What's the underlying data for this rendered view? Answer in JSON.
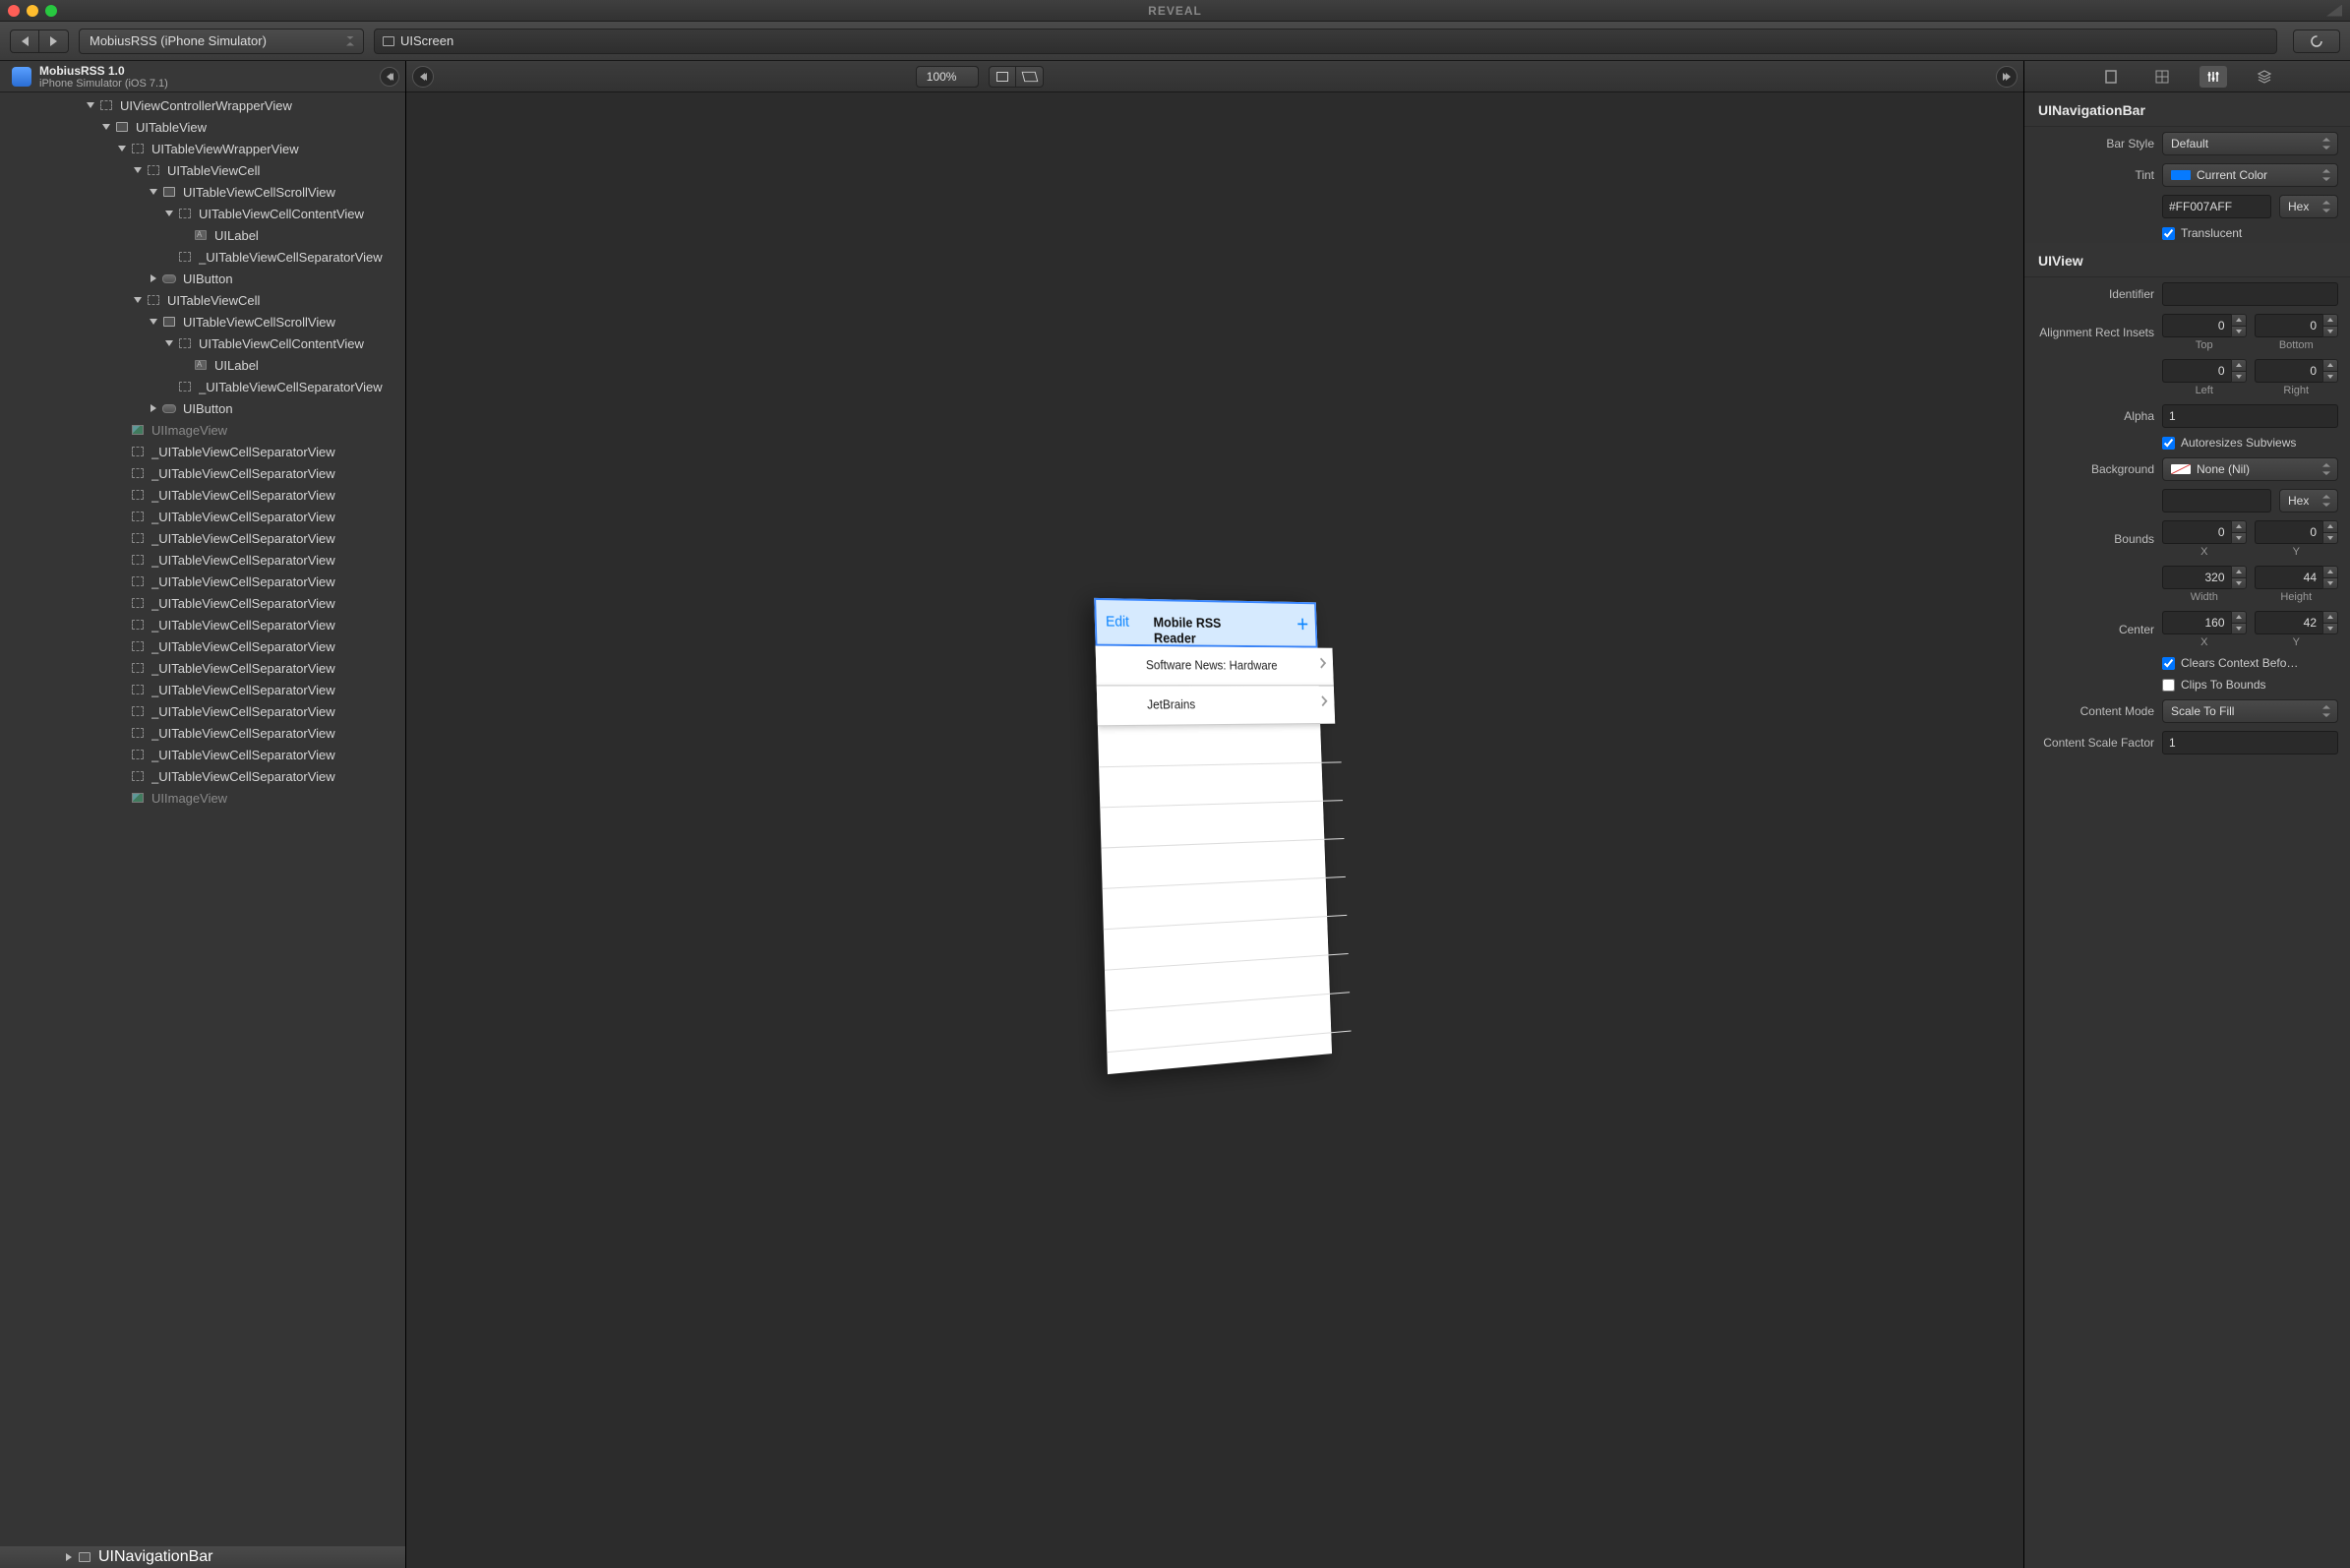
{
  "app": {
    "title": "REVEAL"
  },
  "toolbar": {
    "process": "MobiusRSS (iPhone Simulator)",
    "breadcrumb": "UIScreen"
  },
  "left": {
    "title": "MobiusRSS 1.0",
    "subtitle": "iPhone Simulator (iOS 7.1)",
    "tree": [
      {
        "d": 5,
        "o": true,
        "i": "box",
        "t": "UIViewControllerWrapperView"
      },
      {
        "d": 6,
        "o": true,
        "i": "solid",
        "t": "UITableView"
      },
      {
        "d": 7,
        "o": true,
        "i": "box",
        "t": "UITableViewWrapperView"
      },
      {
        "d": 8,
        "o": true,
        "i": "box",
        "t": "UITableViewCell"
      },
      {
        "d": 9,
        "o": true,
        "i": "solid",
        "t": "UITableViewCellScrollView"
      },
      {
        "d": 10,
        "o": true,
        "i": "box",
        "t": "UITableViewCellContentView"
      },
      {
        "d": 11,
        "o": null,
        "i": "label",
        "t": "UILabel"
      },
      {
        "d": 10,
        "o": null,
        "i": "box",
        "t": "_UITableViewCellSeparatorView"
      },
      {
        "d": 9,
        "o": false,
        "i": "btn",
        "t": "UIButton"
      },
      {
        "d": 8,
        "o": true,
        "i": "box",
        "t": "UITableViewCell"
      },
      {
        "d": 9,
        "o": true,
        "i": "solid",
        "t": "UITableViewCellScrollView"
      },
      {
        "d": 10,
        "o": true,
        "i": "box",
        "t": "UITableViewCellContentView"
      },
      {
        "d": 11,
        "o": null,
        "i": "label",
        "t": "UILabel"
      },
      {
        "d": 10,
        "o": null,
        "i": "box",
        "t": "_UITableViewCellSeparatorView"
      },
      {
        "d": 9,
        "o": false,
        "i": "btn",
        "t": "UIButton"
      },
      {
        "d": 7,
        "o": null,
        "i": "img",
        "t": "UIImageView",
        "dim": true
      },
      {
        "d": 7,
        "o": null,
        "i": "box",
        "t": "_UITableViewCellSeparatorView"
      },
      {
        "d": 7,
        "o": null,
        "i": "box",
        "t": "_UITableViewCellSeparatorView"
      },
      {
        "d": 7,
        "o": null,
        "i": "box",
        "t": "_UITableViewCellSeparatorView"
      },
      {
        "d": 7,
        "o": null,
        "i": "box",
        "t": "_UITableViewCellSeparatorView"
      },
      {
        "d": 7,
        "o": null,
        "i": "box",
        "t": "_UITableViewCellSeparatorView"
      },
      {
        "d": 7,
        "o": null,
        "i": "box",
        "t": "_UITableViewCellSeparatorView"
      },
      {
        "d": 7,
        "o": null,
        "i": "box",
        "t": "_UITableViewCellSeparatorView"
      },
      {
        "d": 7,
        "o": null,
        "i": "box",
        "t": "_UITableViewCellSeparatorView"
      },
      {
        "d": 7,
        "o": null,
        "i": "box",
        "t": "_UITableViewCellSeparatorView"
      },
      {
        "d": 7,
        "o": null,
        "i": "box",
        "t": "_UITableViewCellSeparatorView"
      },
      {
        "d": 7,
        "o": null,
        "i": "box",
        "t": "_UITableViewCellSeparatorView"
      },
      {
        "d": 7,
        "o": null,
        "i": "box",
        "t": "_UITableViewCellSeparatorView"
      },
      {
        "d": 7,
        "o": null,
        "i": "box",
        "t": "_UITableViewCellSeparatorView"
      },
      {
        "d": 7,
        "o": null,
        "i": "box",
        "t": "_UITableViewCellSeparatorView"
      },
      {
        "d": 7,
        "o": null,
        "i": "box",
        "t": "_UITableViewCellSeparatorView"
      },
      {
        "d": 7,
        "o": null,
        "i": "box",
        "t": "_UITableViewCellSeparatorView"
      },
      {
        "d": 7,
        "o": null,
        "i": "img",
        "t": "UIImageView",
        "dim": true
      }
    ],
    "selected": "UINavigationBar"
  },
  "center": {
    "zoom": "100%",
    "nav": {
      "edit": "Edit",
      "title": "Mobile RSS Reader",
      "plus": "+"
    },
    "cells": [
      "Software News: Hardware",
      "JetBrains"
    ]
  },
  "right": {
    "sections": {
      "navbar": {
        "title": "UINavigationBar",
        "barStyle": {
          "label": "Bar Style",
          "value": "Default"
        },
        "tint": {
          "label": "Tint",
          "value": "Current Color"
        },
        "tintHex": {
          "value": "#FF007AFF",
          "fmt": "Hex"
        },
        "translucent": {
          "label": "Translucent",
          "checked": true
        }
      },
      "uiview": {
        "title": "UIView",
        "identifier": {
          "label": "Identifier",
          "value": ""
        },
        "ari": {
          "label": "Alignment Rect Insets",
          "top": "0",
          "bottom": "0",
          "left": "0",
          "right": "0",
          "topL": "Top",
          "bottomL": "Bottom",
          "leftL": "Left",
          "rightL": "Right"
        },
        "alpha": {
          "label": "Alpha",
          "value": "1"
        },
        "autoresize": {
          "label": "Autoresizes Subviews",
          "checked": true
        },
        "background": {
          "label": "Background",
          "value": "None (Nil)",
          "hex": "",
          "fmt": "Hex"
        },
        "bounds": {
          "label": "Bounds",
          "x": "0",
          "y": "0",
          "w": "320",
          "h": "44",
          "xL": "X",
          "yL": "Y",
          "wL": "Width",
          "hL": "Height"
        },
        "center": {
          "label": "Center",
          "x": "160",
          "y": "42",
          "xL": "X",
          "yL": "Y"
        },
        "clears": {
          "label": "Clears Context Befo…",
          "checked": true
        },
        "clips": {
          "label": "Clips To Bounds",
          "checked": false
        },
        "contentMode": {
          "label": "Content Mode",
          "value": "Scale To Fill"
        },
        "csf": {
          "label": "Content Scale Factor",
          "value": "1"
        }
      }
    }
  }
}
